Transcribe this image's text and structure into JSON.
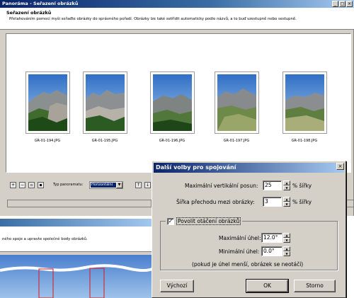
{
  "main_window": {
    "title": "Panoráma - Seřazení obrázků",
    "controls": [
      "_",
      "□",
      "×"
    ],
    "header_title": "Seřazení obrázků",
    "header_desc": "Přetahováním pomocí myši seřaďte obrázky do správného pořadí. Obrázky lze také setřídit automaticky podle názvů, a to buď vzestupně nebo sestupně.",
    "images": [
      {
        "name": "GR-01-194.JPG"
      },
      {
        "name": "GR-01-195.JPG"
      },
      {
        "name": "GR-01-196.JPG"
      },
      {
        "name": "GR-01-197.JPG"
      },
      {
        "name": "GR-01-198.JPG"
      }
    ],
    "toolbar": {
      "panorama_type_label": "Typ panoramatu:",
      "panorama_type_value": "Horizontální"
    }
  },
  "back_window": {
    "desc": "ného spoje a upravte společné body obrázků."
  },
  "dialog": {
    "title": "Další volby pro spojování",
    "close": "×",
    "max_vertical_shift": {
      "label": "Maximální vertikální posun:",
      "value": "25",
      "unit": "% šířky"
    },
    "transition_width": {
      "label": "Šířka přechodu mezi obrázky:",
      "value": "3",
      "unit": "% šířky"
    },
    "allow_rotation": {
      "label": "Povolit otáčení obrázků",
      "checked": true
    },
    "max_angle": {
      "label": "Maximální úhel:",
      "value": "12.0°"
    },
    "min_angle": {
      "label": "Minimální úhel:",
      "value": "0.0°"
    },
    "note": "(pokud je úhel menší, obrázek se neotáčí)",
    "buttons": {
      "default": "Výchozí",
      "ok": "OK",
      "cancel": "Storno"
    }
  }
}
